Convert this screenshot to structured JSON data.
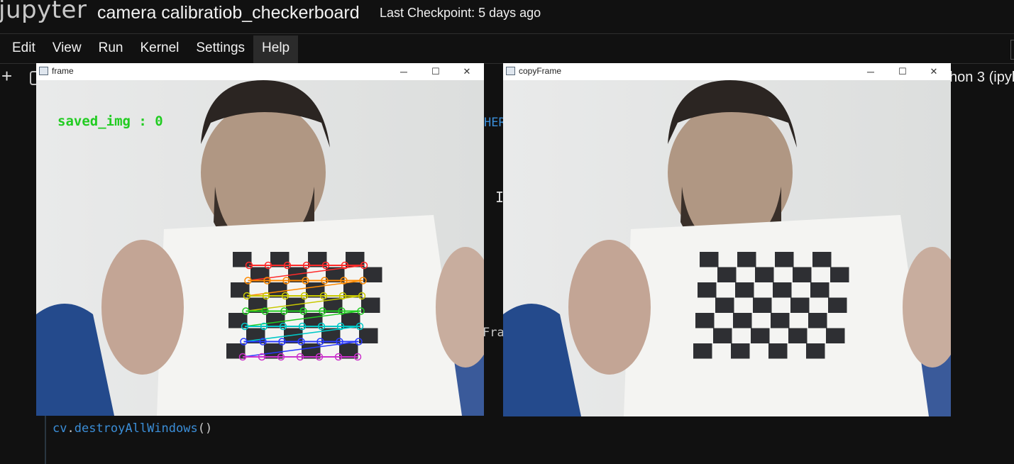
{
  "header": {
    "logo": "jupyter",
    "notebook_title": "camera calibratiob_checkerboard",
    "checkpoint": "Last Checkpoint: 5 days ago"
  },
  "menu": [
    {
      "label": "Edit"
    },
    {
      "label": "View"
    },
    {
      "label": "Run"
    },
    {
      "label": "Kernel"
    },
    {
      "label": "Settings"
    },
    {
      "label": "Help",
      "active": true
    }
  ],
  "toolbar": {
    "add_icon": "+",
    "kernel": "hon 3 (ipyk"
  },
  "code": {
    "frag_her": "HER",
    "frag_fra": "Fra",
    "line_obj": "cv",
    "line_dot": ".",
    "line_fn": "destroyAllWindows",
    "line_parens": "()"
  },
  "windows": {
    "frame": {
      "title": "frame",
      "overlay_text": "saved_img : 0",
      "overlay_color": "#22cc22"
    },
    "copy": {
      "title": "copyFrame"
    }
  },
  "window_controls": {
    "minimize": "─",
    "maximize": "☐",
    "close": "✕"
  },
  "colors": {
    "background": "#111111",
    "code_blue": "#3b8ed8",
    "corner_rows": [
      "#ff2a2a",
      "#ff8a00",
      "#c8c800",
      "#22cc22",
      "#00c8c8",
      "#2a3aff",
      "#cc33cc"
    ]
  }
}
